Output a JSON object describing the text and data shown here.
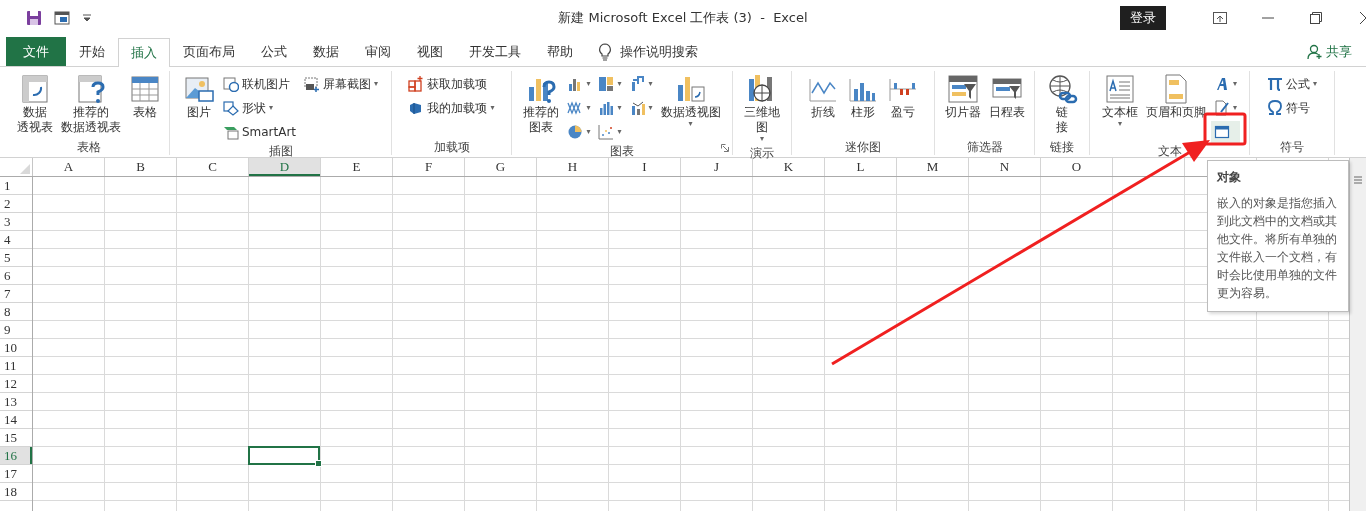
{
  "window": {
    "title": "新建 Microsoft Excel 工作表 (3)  -  Excel",
    "sign_in": "登录"
  },
  "tabs": [
    {
      "label": "文件",
      "kind": "file",
      "selected": false
    },
    {
      "label": "开始",
      "kind": "tab",
      "selected": false
    },
    {
      "label": "插入",
      "kind": "tab",
      "selected": true
    },
    {
      "label": "页面布局",
      "kind": "tab",
      "selected": false
    },
    {
      "label": "公式",
      "kind": "tab",
      "selected": false
    },
    {
      "label": "数据",
      "kind": "tab",
      "selected": false
    },
    {
      "label": "审阅",
      "kind": "tab",
      "selected": false
    },
    {
      "label": "视图",
      "kind": "tab",
      "selected": false
    },
    {
      "label": "开发工具",
      "kind": "tab",
      "selected": false
    },
    {
      "label": "帮助",
      "kind": "tab",
      "selected": false
    }
  ],
  "tell_me": "操作说明搜索",
  "share": "共享",
  "ribbon": {
    "groups": [
      {
        "label": "表格",
        "columns": [
          [
            {
              "kind": "large",
              "lines": [
                "数据",
                "透视表"
              ]
            }
          ],
          [
            {
              "kind": "large",
              "lines": [
                "推荐的",
                "数据透视表"
              ]
            }
          ],
          [
            {
              "kind": "large",
              "lines": [
                "表格"
              ]
            }
          ]
        ]
      },
      {
        "label": "插图",
        "columns": [
          [
            {
              "kind": "large",
              "lines": [
                "图片"
              ]
            }
          ],
          [
            {
              "kind": "small",
              "label": "联机图片"
            },
            {
              "kind": "small",
              "label": "形状",
              "caret": "▾"
            },
            {
              "kind": "small",
              "label": "SmartArt"
            }
          ],
          [
            {
              "kind": "small",
              "label": "屏幕截图",
              "caret": "▾"
            }
          ]
        ]
      },
      {
        "label": "加载项",
        "columns": [
          [
            {
              "kind": "small",
              "label": "获取加载项"
            },
            {
              "kind": "small",
              "label": "我的加载项",
              "caret": "▾"
            }
          ]
        ]
      },
      {
        "label": "图表",
        "launcher": true,
        "columns": [
          [
            {
              "kind": "large",
              "lines": [
                "推荐的",
                "图表"
              ]
            }
          ],
          [
            {
              "kind": "icon",
              "caret": "▾"
            },
            {
              "kind": "icon",
              "caret": "▾"
            },
            {
              "kind": "icon",
              "caret": "▾"
            }
          ],
          [
            {
              "kind": "icon",
              "caret": "▾"
            },
            {
              "kind": "icon",
              "caret": "▾"
            },
            {
              "kind": "icon",
              "caret": "▾"
            }
          ],
          [
            {
              "kind": "icon",
              "caret": "▾"
            },
            {
              "kind": "icon",
              "caret": "▾"
            }
          ],
          [
            {
              "kind": "large",
              "lines": [
                "数据透视图"
              ],
              "caret": "▾"
            }
          ]
        ]
      },
      {
        "label": "演示",
        "columns": [
          [
            {
              "kind": "large",
              "lines": [
                "三维地",
                "图"
              ],
              "caret": "▾"
            }
          ]
        ]
      },
      {
        "label": "迷你图",
        "columns": [
          [
            {
              "kind": "large",
              "lines": [
                "折线"
              ]
            }
          ],
          [
            {
              "kind": "large",
              "lines": [
                "柱形"
              ]
            }
          ],
          [
            {
              "kind": "large",
              "lines": [
                "盈亏"
              ]
            }
          ]
        ]
      },
      {
        "label": "筛选器",
        "columns": [
          [
            {
              "kind": "large",
              "lines": [
                "切片器"
              ]
            }
          ],
          [
            {
              "kind": "large",
              "lines": [
                "日程表"
              ]
            }
          ]
        ]
      },
      {
        "label": "链接",
        "columns": [
          [
            {
              "kind": "large",
              "lines": [
                "链",
                "接"
              ]
            }
          ]
        ]
      },
      {
        "label": "文本",
        "columns": [
          [
            {
              "kind": "large",
              "lines": [
                "文本框"
              ],
              "caret": "▾"
            }
          ],
          [
            {
              "kind": "large",
              "lines": [
                "页眉和页脚"
              ]
            }
          ],
          [
            {
              "kind": "icon",
              "caret": "▾",
              "hovered": false
            },
            {
              "kind": "icon",
              "caret": "▾",
              "hovered": false
            },
            {
              "kind": "icon",
              "hovered": true
            }
          ]
        ]
      },
      {
        "label": "符号",
        "columns": [
          [
            {
              "kind": "small",
              "label": "公式",
              "caret": "▾"
            },
            {
              "kind": "small",
              "label": "符号"
            }
          ]
        ]
      }
    ]
  },
  "tooltip": {
    "title": "对象",
    "text": "嵌入的对象是指您插入到此文档中的文档或其他文件。将所有单独的文件嵌入一个文档，有时会比使用单独的文件更为容易。"
  },
  "sheet": {
    "columns": [
      {
        "label": "A",
        "selected": false
      },
      {
        "label": "B",
        "selected": false
      },
      {
        "label": "C",
        "selected": false
      },
      {
        "label": "D",
        "selected": true
      },
      {
        "label": "E",
        "selected": false
      },
      {
        "label": "F",
        "selected": false
      },
      {
        "label": "G",
        "selected": false
      },
      {
        "label": "H",
        "selected": false
      },
      {
        "label": "I",
        "selected": false
      },
      {
        "label": "J",
        "selected": false
      },
      {
        "label": "K",
        "selected": false
      },
      {
        "label": "L",
        "selected": false
      },
      {
        "label": "M",
        "selected": false
      },
      {
        "label": "N",
        "selected": false
      },
      {
        "label": "O",
        "selected": false
      }
    ],
    "rows": [
      {
        "label": "1",
        "selected": false
      },
      {
        "label": "2",
        "selected": false
      },
      {
        "label": "3",
        "selected": false
      },
      {
        "label": "4",
        "selected": false
      },
      {
        "label": "5",
        "selected": false
      },
      {
        "label": "6",
        "selected": false
      },
      {
        "label": "7",
        "selected": false
      },
      {
        "label": "8",
        "selected": false
      },
      {
        "label": "9",
        "selected": false
      },
      {
        "label": "10",
        "selected": false
      },
      {
        "label": "11",
        "selected": false
      },
      {
        "label": "12",
        "selected": false
      },
      {
        "label": "13",
        "selected": false
      },
      {
        "label": "14",
        "selected": false
      },
      {
        "label": "15",
        "selected": false
      },
      {
        "label": "16",
        "selected": true
      },
      {
        "label": "17",
        "selected": false
      },
      {
        "label": "18",
        "selected": false
      }
    ]
  }
}
